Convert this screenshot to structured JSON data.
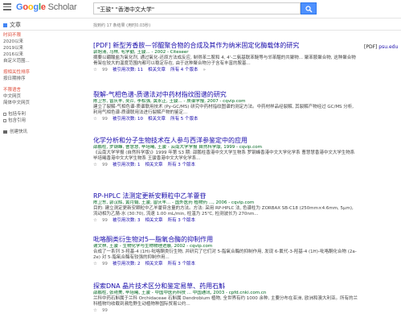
{
  "header": {
    "logo_google": [
      "G",
      "o",
      "o",
      "g",
      "l",
      "e"
    ],
    "logo_scholar": "Scholar",
    "search_value": "\"王骏\" \"香港中文大学\"",
    "articles_label": "文章",
    "result_count": "找到约 17 条结果 (用时0.03秒)"
  },
  "sidebar": {
    "time": [
      "时间不限",
      "2020以来",
      "2019以来",
      "2016以来",
      "自定义范围..."
    ],
    "sort": [
      "按相关性排序",
      "按日期排序"
    ],
    "lang": [
      "不限语言",
      "中文网页",
      "简体中文网页"
    ],
    "options": [
      "包括专利",
      "包含引用"
    ],
    "alert": "创建快讯"
  },
  "pdf": {
    "tag": "[PDF]",
    "domain": "psu.edu"
  },
  "results": [
    {
      "title": "[PDF] 新型芳香胺—邻醌聚合物的合成及其作为纳米固定化酶载体的研究",
      "meta": "郭旭清, 马林, 毛学勤, 王骏... - 2002 - Citeseer",
      "snippet": "摘要以硼酸盐为氧化剂, 通过氧化-还原方法成反应, 制得苯二胺和 4, 4'-二氨基联苯醚等与邻苯醌的共聚物... 聚苯胺聚合物, 这种聚合物骨架在较大的温度范围内都可以稳定存在, 由于这种聚合物分子含有丰富的胺基...",
      "actions": [
        "☆",
        "99",
        "被引用次数: 11",
        "相关文章",
        "所有 4 个版本",
        "»"
      ]
    },
    {
      "title": "裂解-气相色谱-质谱法对中药材指纹图谱的研究",
      "meta": "陈卫东, 曾庆丰, 吴芹, 李松强, 黄永正, 王骏... - 质谱学报, 2007 - cqvip.com",
      "snippet": "建立了裂解-气相色谱-质谱联用技术 (Py-GC/MS) 研究中药材指纹图谱的测定方法。中药材样品经裂解, 其裂解产物经过 GC/MS 分析, 利用气相色谱-质谱联用法进行裂解产物的鉴定...",
      "actions": [
        "☆",
        "99",
        "被引用次数: 10",
        "相关文章",
        "所有 5 个版本",
        ""
      ]
    },
    {
      "title": "化学分析和分子生物技术在人参与西洋参鉴定中的应用",
      "meta": "邵鹏柱, 罗钢峰, 曹慧慧, 毕培曦, 王骏 - 云南大学学报 自然科学版, 1999 - cqvip.com",
      "snippet": "《云南大学学报 (自然科学版)》1999 年第 S3 期: 邵鹏柱香港中文大学生物系 罗钢峰香港中文大学化学系 曹慧慧香港中文大学生物系 毕培曦香港中文大学生物系 王骏香港中文大学化学系...",
      "actions": [
        "☆",
        "99",
        "被引用次数: 1",
        "相关文章",
        "所有 3 个版本",
        ""
      ]
    },
    {
      "title": "RP-HPLC 法测定更新安颗粒中乙羊藿苷",
      "meta": "陈卫东, 郭汉辉, 黄月娟, 王骏, 曾庆丰... - 国外医药 植物药 ..., 2006 - cqvip.com",
      "snippet": "目的: 建立测定更新安颗粒中乙羊藿苷含量的方法。方法: 采用 RP-HPLC 法, 色谱柱为 ZORBAX SB-C18 (250mm×4.6mm, 5μm), 流动相为乙腈-水 (30:70), 流速 1.00 mL/min, 柱温为 25℃, 检测波长为 270nm...",
      "actions": [
        "☆",
        "99",
        "被引用次数: 3",
        "相关文章",
        "所有 3 个版本",
        ""
      ]
    },
    {
      "title": "吡咯酮类衍生物对5—脂氧合酶的抑制作用",
      "meta": "谢文林, 王骏 - 生物化学与生物物理进展, 2002 - cqvip.com",
      "snippet": "合成了一系列 3-羟基-4 (1H)-吡咯酮类衍生物, 并研究了它们对 5-脂氧合酶的抑制作用, 发现 6-氟代-3-羟基-4 (1H)-吡咯酮化合物 (2a-2e) 对 5-脂氧合酶有较强的抑制作用...",
      "actions": [
        "☆",
        "99",
        "被引用次数: 2",
        "相关文章",
        "所有 3 个版本",
        ""
      ]
    },
    {
      "title": "探索DNA 晶片技术区分和鉴定易草、药用石斛",
      "meta": "邵鹏柱, 张艳美, 毕培曦, 王骏 - 中国中医药科技 ... 中国通讯, 2003 - cpfd.cnki.com.cn",
      "snippet": "兰科中药石斛属于兰科 Orchidaceae 石斛属 Dendrobium 植物, 全世界有约 1000 余种, 主要分布在亚洲, 欧洲和澳大利亚。所有的兰科植物均收载到濒危野生动植物种国际贸易公约...",
      "actions": [
        "☆",
        "99",
        "",
        "",
        "",
        ""
      ]
    }
  ]
}
